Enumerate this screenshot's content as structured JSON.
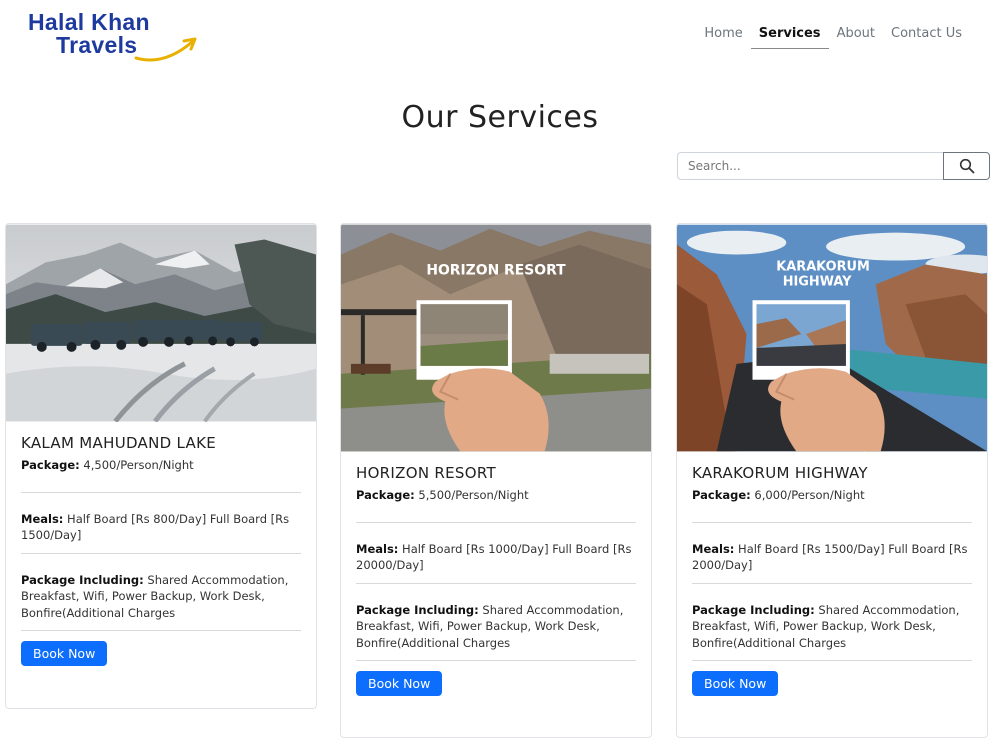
{
  "brand": {
    "line1": "Halal Khan",
    "line2": "Travels",
    "color": "#1e3a9e",
    "swoosh_color": "#e8b100"
  },
  "nav": {
    "items": [
      {
        "label": "Home"
      },
      {
        "label": "Services"
      },
      {
        "label": "About"
      },
      {
        "label": "Contact Us"
      }
    ],
    "active": "Services"
  },
  "page": {
    "title": "Our Services"
  },
  "search": {
    "placeholder": "Search...",
    "value": "",
    "icon": "search-icon"
  },
  "cards": [
    {
      "title": "KALAM MAHUDAND LAKE",
      "image_caption": "",
      "package_label": "Package:",
      "package_value": "4,500/Person/Night",
      "meals_label": "Meals:",
      "meals_value": "Half Board [Rs 800/Day] Full Board [Rs 1500/Day]",
      "including_label": "Package Including:",
      "including_value": "Shared Accommodation, Breakfast, Wifi, Power Backup, Work Desk, Bonfire(Additional Charges",
      "button": "Book Now"
    },
    {
      "title": "HORIZON RESORT",
      "image_caption": "HORIZON RESORT",
      "package_label": "Package:",
      "package_value": "5,500/Person/Night",
      "meals_label": "Meals:",
      "meals_value": "Half Board [Rs 1000/Day] Full Board [Rs 20000/Day]",
      "including_label": "Package Including:",
      "including_value": "Shared Accommodation, Breakfast, Wifi, Power Backup, Work Desk, Bonfire(Additional Charges",
      "button": "Book Now"
    },
    {
      "title": "KARAKORUM HIGHWAY",
      "image_caption_line1": "KARAKORUM",
      "image_caption_line2": "HIGHWAY",
      "package_label": "Package:",
      "package_value": "6,000/Person/Night",
      "meals_label": "Meals:",
      "meals_value": "Half Board [Rs 1500/Day] Full Board [Rs 2000/Day]",
      "including_label": "Package Including:",
      "including_value": "Shared Accommodation, Breakfast, Wifi, Power Backup, Work Desk, Bonfire(Additional Charges",
      "button": "Book Now"
    }
  ],
  "colors": {
    "primary_button": "#0d6efd",
    "card_border": "#dfe2e6"
  }
}
